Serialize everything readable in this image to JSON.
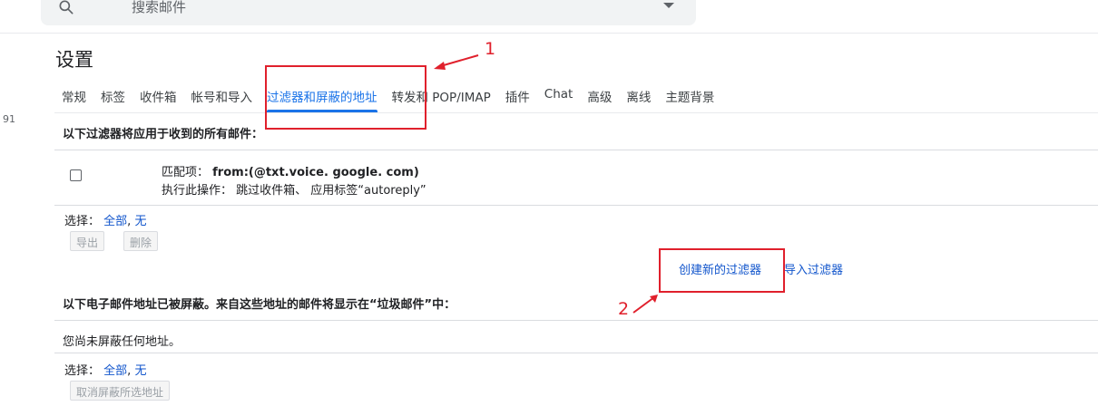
{
  "search": {
    "placeholder": "搜索邮件"
  },
  "left_number": "91",
  "page_title": "设置",
  "tabs": [
    {
      "label": "常规"
    },
    {
      "label": "标签"
    },
    {
      "label": "收件箱"
    },
    {
      "label": "帐号和导入"
    },
    {
      "label": "过滤器和屏蔽的地址"
    },
    {
      "label": "转发和 POP/IMAP"
    },
    {
      "label": "插件"
    },
    {
      "label": "Chat"
    },
    {
      "label": "高级"
    },
    {
      "label": "离线"
    },
    {
      "label": "主题背景"
    }
  ],
  "active_tab": "过滤器和屏蔽的地址",
  "filters_section": {
    "header": "以下过滤器将应用于收到的所有邮件：",
    "filter": {
      "match_label": "匹配项：",
      "match_value": "from:(@txt.voice. google. com)",
      "action_label": "执行此操作：",
      "action_value": "跳过收件箱、 应用标签“autoreply”"
    },
    "select_label": "选择：",
    "select_all": "全部",
    "select_none": "无",
    "export_button": "导出",
    "delete_button": "删除",
    "create_filter": "创建新的过滤器",
    "import_filter": "导入过滤器"
  },
  "blocked_section": {
    "header": "以下电子邮件地址已被屏蔽。来自这些地址的邮件将显示在“垃圾邮件”中：",
    "empty_text": "您尚未屏蔽任何地址。",
    "select_label": "选择：",
    "select_all": "全部",
    "select_none": "无",
    "unblock_button": "取消屏蔽所选地址"
  },
  "annotations": {
    "one": "1",
    "two": "2",
    "color": "#e0202c"
  },
  "colors": {
    "accent": "#1a73e8",
    "link": "#1155cc"
  }
}
